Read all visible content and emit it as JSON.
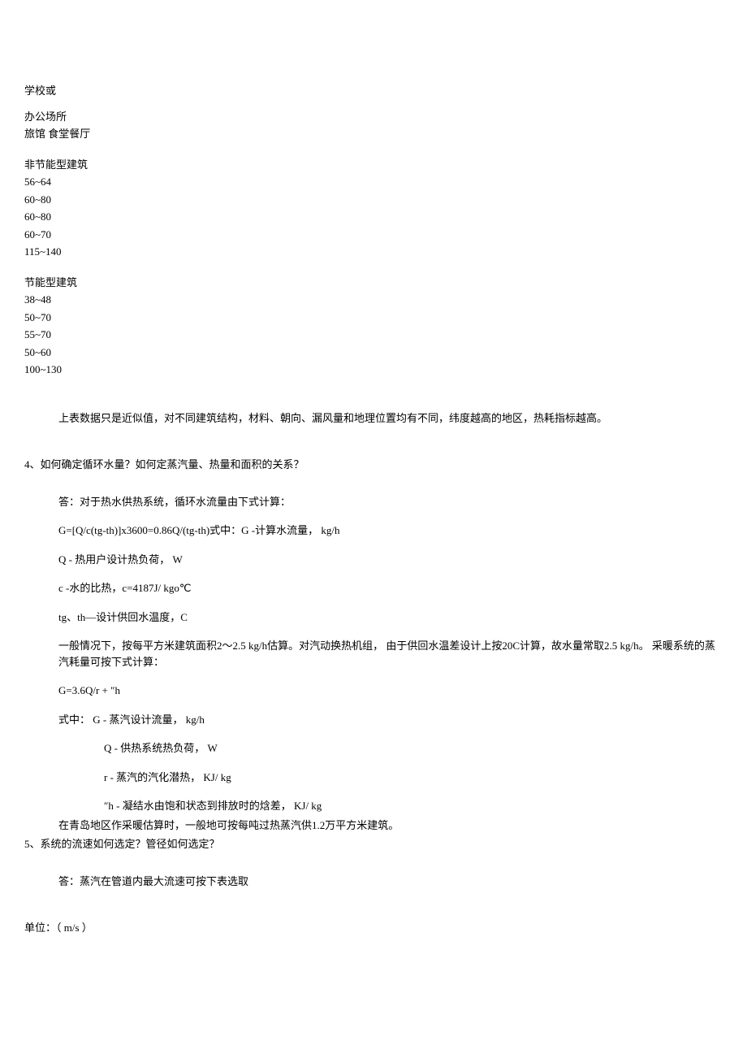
{
  "header": {
    "l1": "学校或",
    "l2": "办公场所",
    "l3": "旅馆  食堂餐厅"
  },
  "sec1": {
    "title": "非节能型建筑",
    "v1": "56~64",
    "v2": "60~80",
    "v3": "60~80",
    "v4": "60~70",
    "v5": "115~140"
  },
  "sec2": {
    "title": "节能型建筑",
    "v1": "38~48",
    "v2": "50~70",
    "v3": "55~70",
    "v4": "50~60",
    "v5": "100~130"
  },
  "note": "上表数据只是近似值，对不同建筑结构，材料、朝向、漏风量和地理位置均有不同，纬度越高的地区，热耗指标越高。",
  "q4": {
    "title": "4、如何确定循环水量？如何定蒸汽量、热量和面积的关系？",
    "a1": "答：对于热水供热系统，循环水流量由下式计算：",
    "a2": "G=[Q/c(tg-th)]x3600=0.86Q/(tg-th)式中：G -计算水流量， kg/h",
    "a3": "Q - 热用户设计热负荷，  W",
    "a4": "c -水的比热，c=4187J/ kgo℃",
    "a5": "tg、th—设计供回水温度，C",
    "a6": "一般情况下，按每平方米建筑面积2〜2.5 kg/h估算。对汽动换热机组，  由于供回水温差设计上按20C计算，故水量常取2.5 kg/h。  采暖系统的蒸汽耗量可按下式计算：",
    "a7": "G=3.6Q/r + ″h",
    "a8": "式中：  G - 蒸汽设计流量，  kg/h",
    "a9": "Q - 供热系统热负荷，  W",
    "a10": "r - 蒸汽的汽化潜热，  KJ/ kg",
    "a11": "″h - 凝结水由饱和状态到排放时的焓差，  KJ/ kg",
    "a12": "在青岛地区作采暖估算时，一般地可按每吨过热蒸汽供1.2万平方米建筑。"
  },
  "q5": {
    "title": "5、系统的流速如何选定？管径如何选定？",
    "a1": "答：蒸汽在管道内最大流速可按下表选取",
    "unit": "单位：（ m/s ）"
  }
}
